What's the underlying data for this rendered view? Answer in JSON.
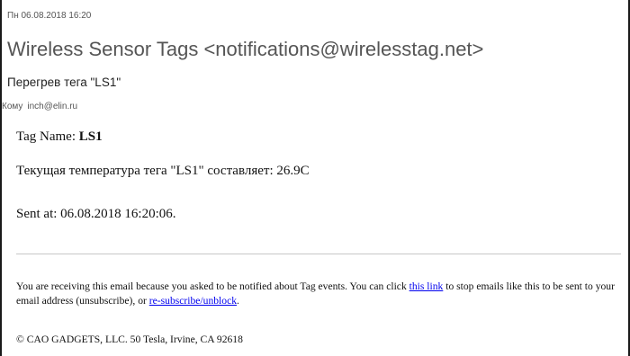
{
  "header": {
    "date": "Пн 06.08.2018 16:20",
    "sender": "Wireless Sensor Tags <notifications@wirelesstag.net>",
    "subject": "Перегрев тега \"LS1\"",
    "to_label": "Кому",
    "to_value": "inch@elin.ru"
  },
  "body": {
    "tag_name_label": "Tag Name: ",
    "tag_name_value": "LS1",
    "temperature_line": "Текущая температура тега \"LS1\" составляет: 26.9C",
    "sent_at_line": "Sent at: 06.08.2018 16:20:06."
  },
  "footer": {
    "notice_part1": "You are receiving this email because you asked to be notified about Tag events. You can click ",
    "link1_text": "this link",
    "notice_part2": " to stop emails like this to be sent to your email address (unsubscribe), or ",
    "link2_text": "re-subscribe/unblock",
    "notice_part3": ".",
    "copyright": "© CAO GADGETS, LLC. 50 Tesla, Irvine, CA 92618"
  },
  "colors": {
    "link": "#0000ee",
    "header_text": "#555555",
    "divider": "#c8c8c8"
  }
}
